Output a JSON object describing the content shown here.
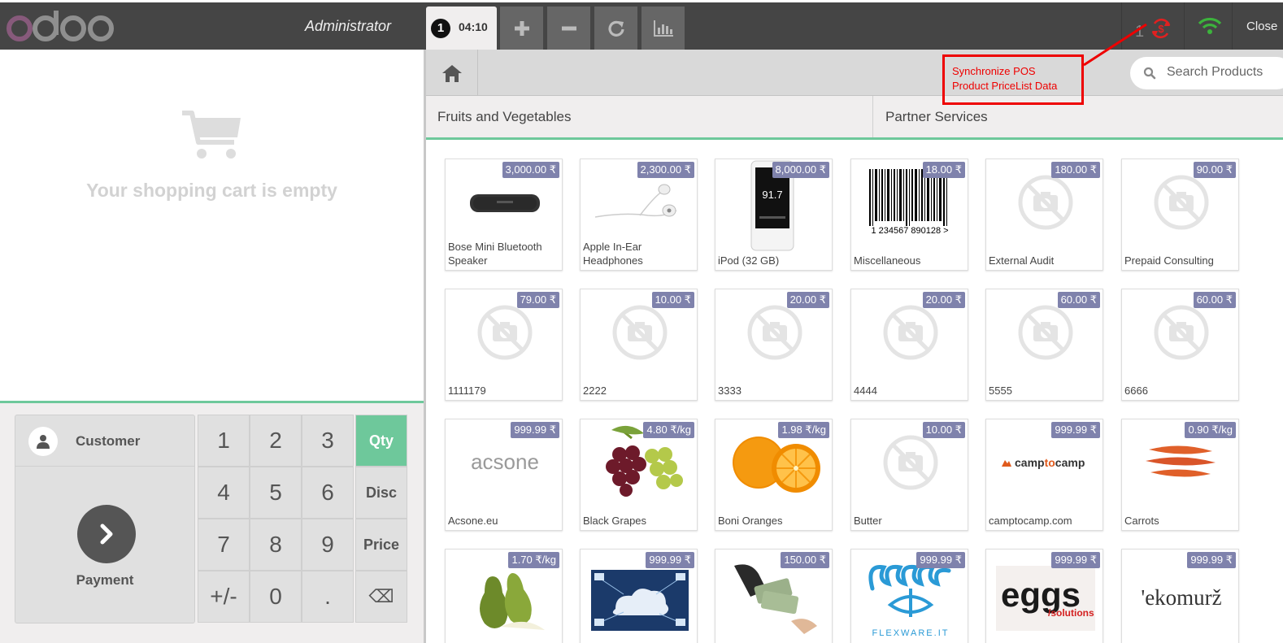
{
  "header": {
    "user": "Administrator",
    "order_number": "1",
    "order_time": "04:10",
    "sync_count": "1",
    "close_label": "Close"
  },
  "cart": {
    "empty_message": "Your shopping cart is empty"
  },
  "actionpad": {
    "customer_label": "Customer",
    "payment_label": "Payment"
  },
  "numpad": {
    "keys": [
      "1",
      "2",
      "3",
      "Qty",
      "4",
      "5",
      "6",
      "Disc",
      "7",
      "8",
      "9",
      "Price",
      "+/-",
      "0",
      ".",
      "⌫"
    ]
  },
  "search": {
    "placeholder": "Search Products"
  },
  "categories": [
    "Fruits and Vegetables",
    "Partner Services"
  ],
  "annotation": {
    "line1": "Synchronize POS",
    "line2": "Product PriceList Data"
  },
  "products": [
    {
      "name": "Bose Mini Bluetooth Speaker",
      "price": "3,000.00 ₹"
    },
    {
      "name": "Apple In-Ear Headphones",
      "price": "2,300.00 ₹"
    },
    {
      "name": "iPod (32 GB)",
      "price": "8,000.00 ₹"
    },
    {
      "name": "Miscellaneous",
      "price": "18.00 ₹"
    },
    {
      "name": "External Audit",
      "price": "180.00 ₹"
    },
    {
      "name": "Prepaid Consulting",
      "price": "90.00 ₹"
    },
    {
      "name": "1111179",
      "price": "79.00 ₹"
    },
    {
      "name": "2222",
      "price": "10.00 ₹"
    },
    {
      "name": "3333",
      "price": "20.00 ₹"
    },
    {
      "name": "4444",
      "price": "20.00 ₹"
    },
    {
      "name": "5555",
      "price": "60.00 ₹"
    },
    {
      "name": "6666",
      "price": "60.00 ₹"
    },
    {
      "name": "Acsone.eu",
      "price": "999.99 ₹",
      "logo": "acsone"
    },
    {
      "name": "Black Grapes",
      "price": "4.80 ₹/kg"
    },
    {
      "name": "Boni Oranges",
      "price": "1.98 ₹/kg"
    },
    {
      "name": "Butter",
      "price": "10.00 ₹"
    },
    {
      "name": "camptocamp.com",
      "price": "999.99 ₹",
      "logo": "camptocamp"
    },
    {
      "name": "Carrots",
      "price": "0.90 ₹/kg"
    },
    {
      "name": "",
      "price": "1.70 ₹/kg"
    },
    {
      "name": "",
      "price": "999.99 ₹"
    },
    {
      "name": "",
      "price": "150.00 ₹"
    },
    {
      "name": "",
      "price": "999.99 ₹",
      "logo": "FLEXWARE.IT"
    },
    {
      "name": "",
      "price": "999.99 ₹",
      "logo": "eggs",
      "logo_sub": "/solutions"
    },
    {
      "name": "",
      "price": "999.99 ₹",
      "logo": "'ekomurž"
    }
  ],
  "colors": {
    "topbar": "#454545",
    "accent_green": "#6ec89b",
    "price_badge": "#7f82ac",
    "annotation_red": "#e00000",
    "logo_purple": "#875a7b"
  }
}
